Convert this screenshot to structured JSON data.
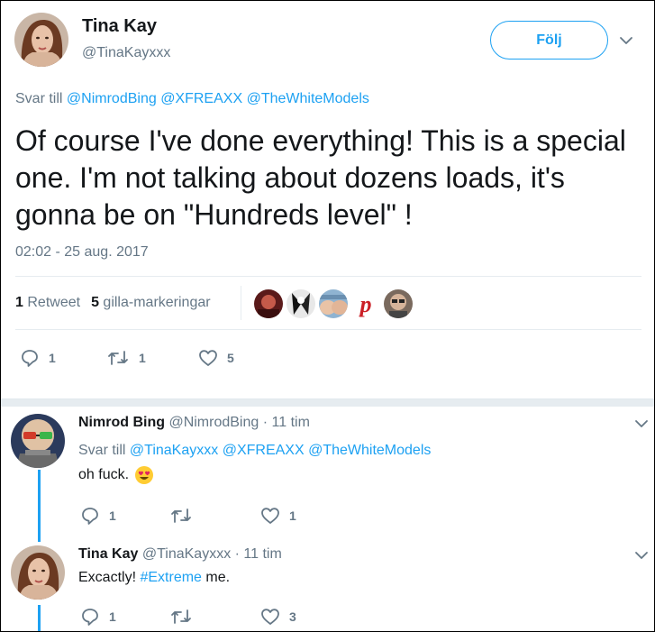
{
  "tweet": {
    "author_name": "Tina Kay",
    "author_handle": "@TinaKayxxx",
    "follow_label": "Följ",
    "reply_prefix": "Svar till",
    "reply_mentions": [
      "@NimrodBing",
      "@XFREAXX",
      "@TheWhiteModels"
    ],
    "text": "Of course I've done everything! This is a special one. I'm not talking about dozens loads, it's gonna be on \"Hundreds level\" !",
    "timestamp": "02:02 - 25 aug. 2017",
    "retweet_count": "1",
    "retweet_label": "Retweet",
    "like_count": "5",
    "like_label": "gilla-markeringar",
    "actions": {
      "reply_count": "1",
      "retweet_count": "1",
      "like_count": "5"
    },
    "liker_avatars": [
      "avatar-red",
      "avatar-bw",
      "avatar-skin",
      "pinterest-logo-avatar",
      "avatar-man"
    ]
  },
  "replies": [
    {
      "author_name": "Nimrod Bing",
      "author_handle": "@NimrodBing",
      "time": "· 11 tim",
      "reply_prefix": "Svar till",
      "reply_mentions": [
        "@TinaKayxxx",
        "@XFREAXX",
        "@TheWhiteModels"
      ],
      "text": "oh fuck.",
      "emoji": "heart-eyes-emoji",
      "reply_count": "1",
      "retweet_count": "",
      "like_count": "1"
    },
    {
      "author_name": "Tina Kay",
      "author_handle": "@TinaKayxxx",
      "time": "· 11 tim",
      "text_before": "Excactly! ",
      "hashtag": "#Extreme",
      "text_after": " me.",
      "reply_count": "1",
      "retweet_count": "",
      "like_count": "3"
    }
  ],
  "colors": {
    "accent": "#1da1f2",
    "text": "#14171a",
    "muted": "#657786",
    "divider": "#e6ecf0"
  }
}
